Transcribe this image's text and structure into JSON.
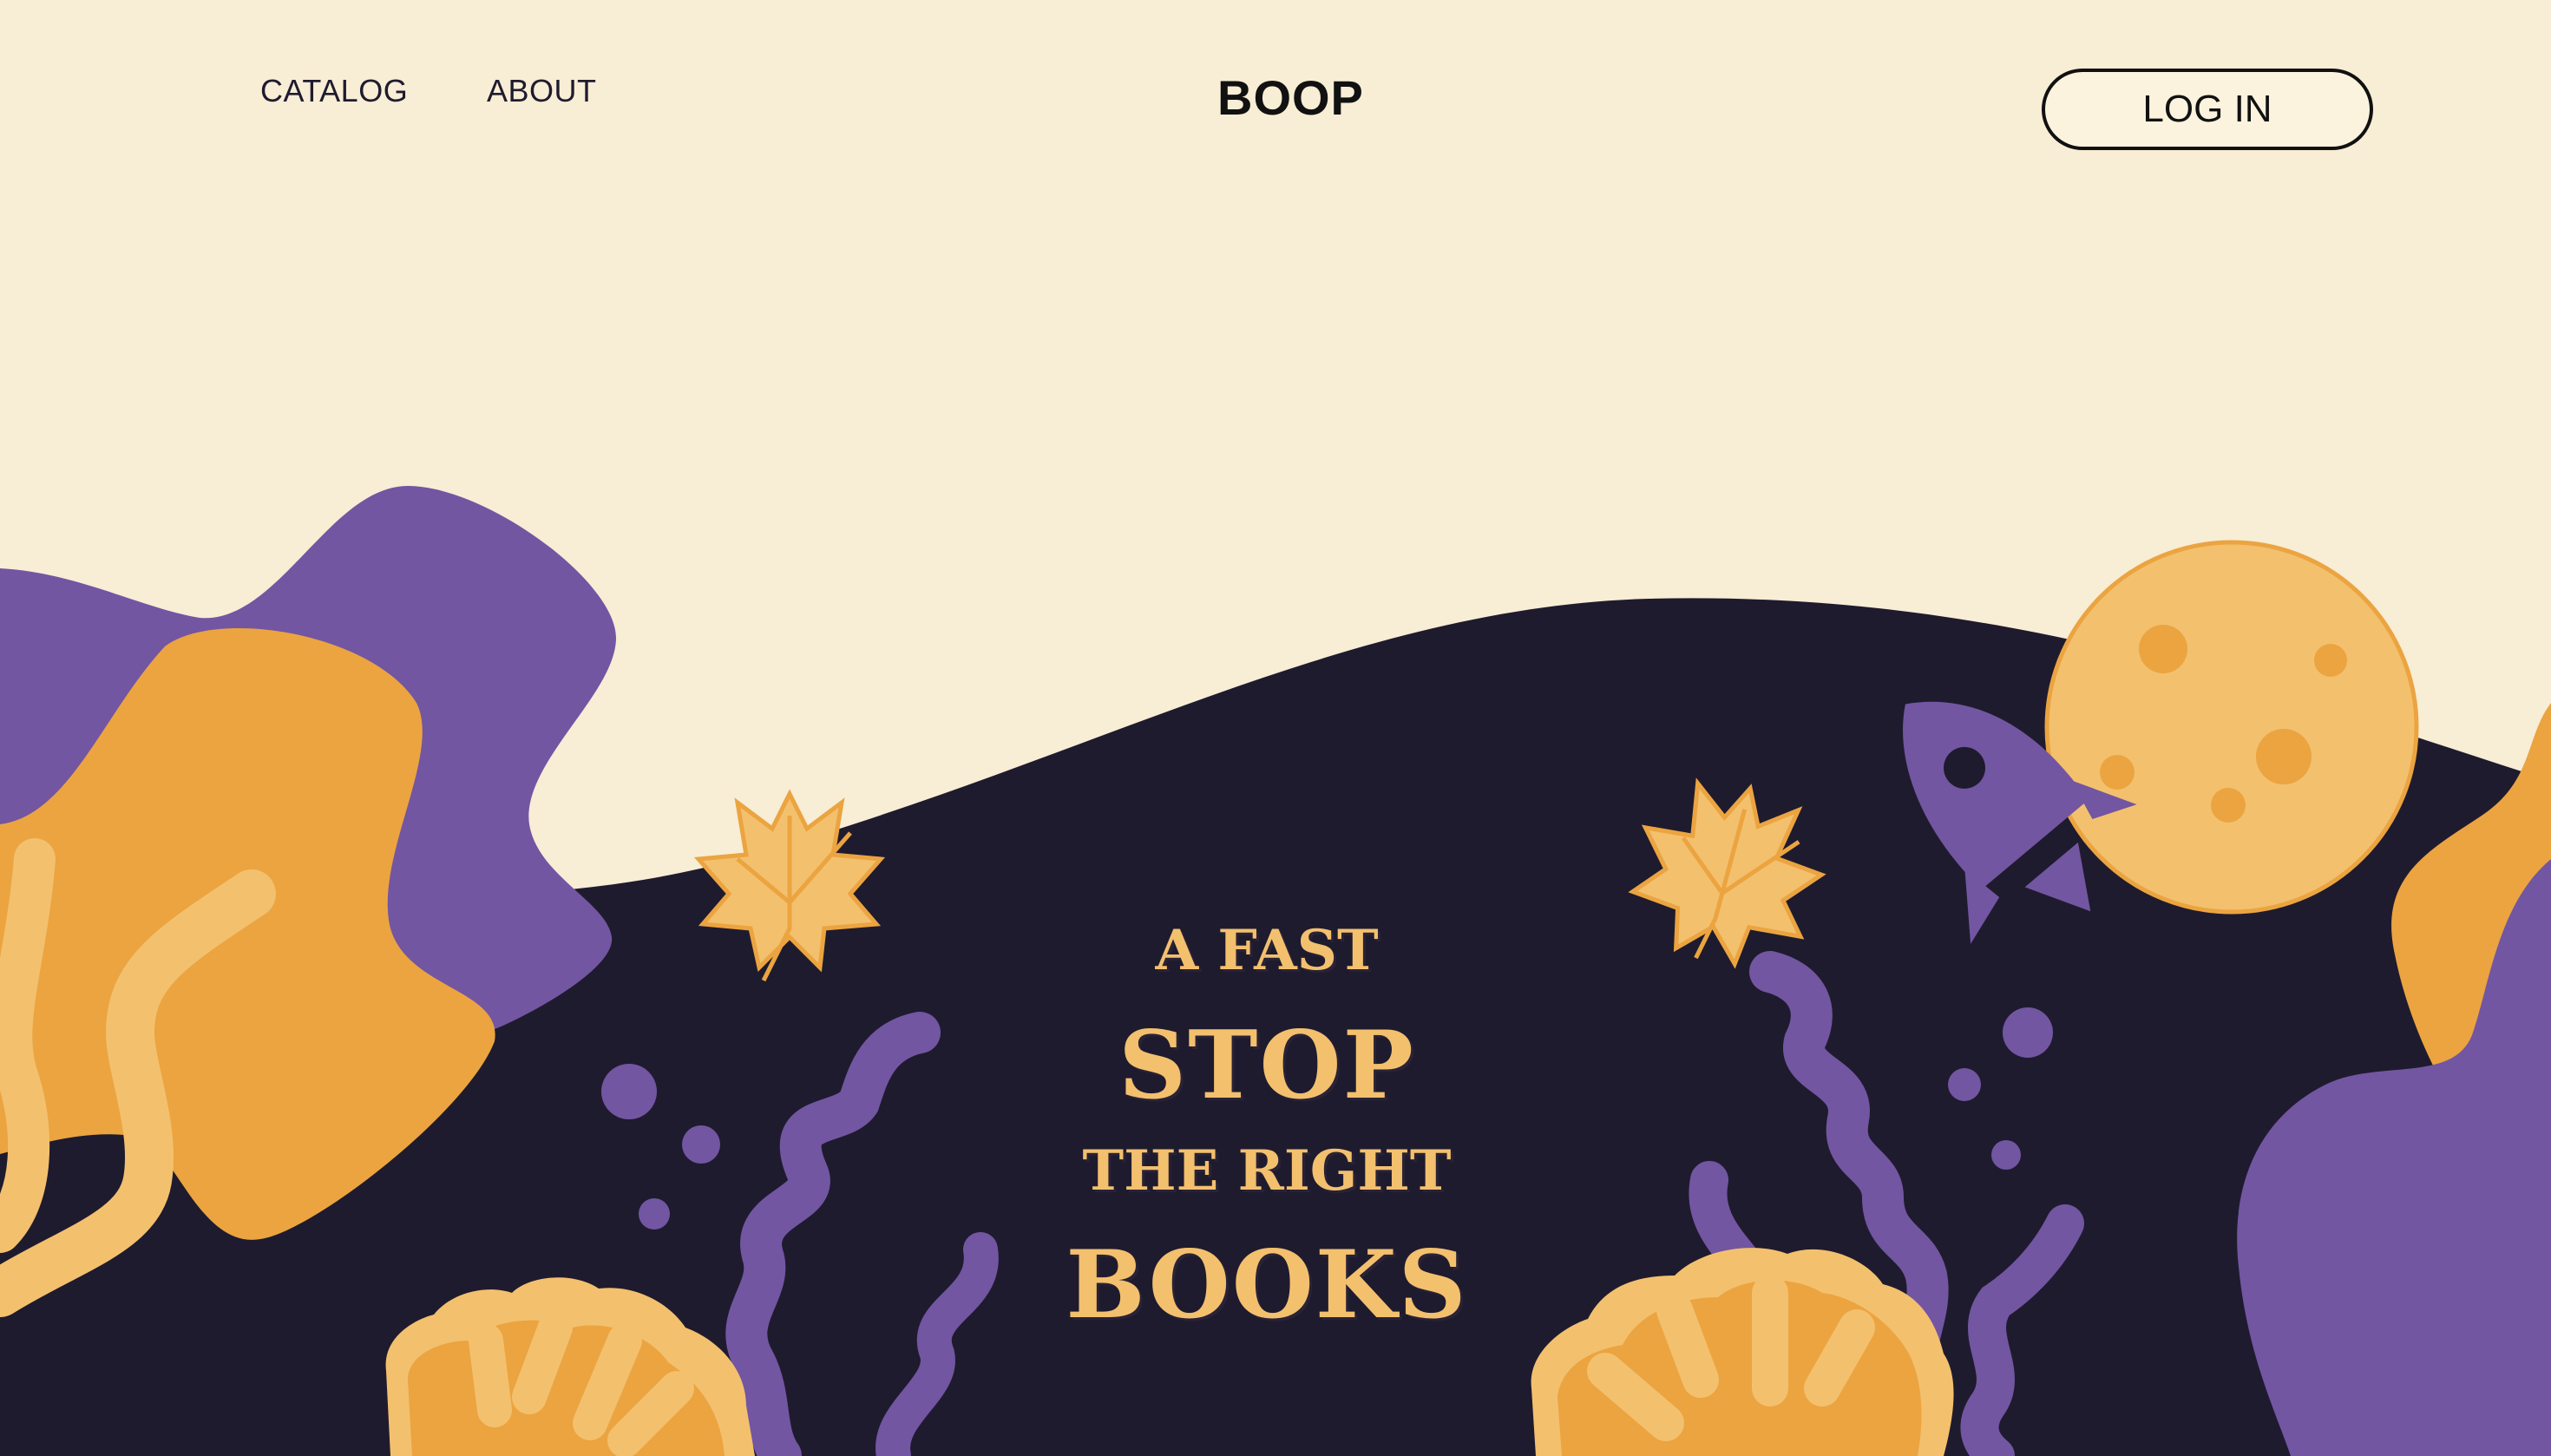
{
  "nav": {
    "catalog": "CATALOG",
    "about": "ABOUT"
  },
  "brand": {
    "logo": "BOOP"
  },
  "auth": {
    "login_label": "LOG IN"
  },
  "hero": {
    "line1": "A FAST",
    "line2": "STOP",
    "line3": "THE RIGHT",
    "line4": "BOOKS"
  },
  "colors": {
    "cream": "#f8edd5",
    "navy": "#1f1b2e",
    "purple": "#7256a2",
    "orange": "#eba440",
    "light_orange": "#f3c06e"
  },
  "icons": [
    "maple-leaf-icon",
    "rocket-icon",
    "moon-icon",
    "seaweed-icon",
    "shell-icon",
    "bubble-icon"
  ]
}
